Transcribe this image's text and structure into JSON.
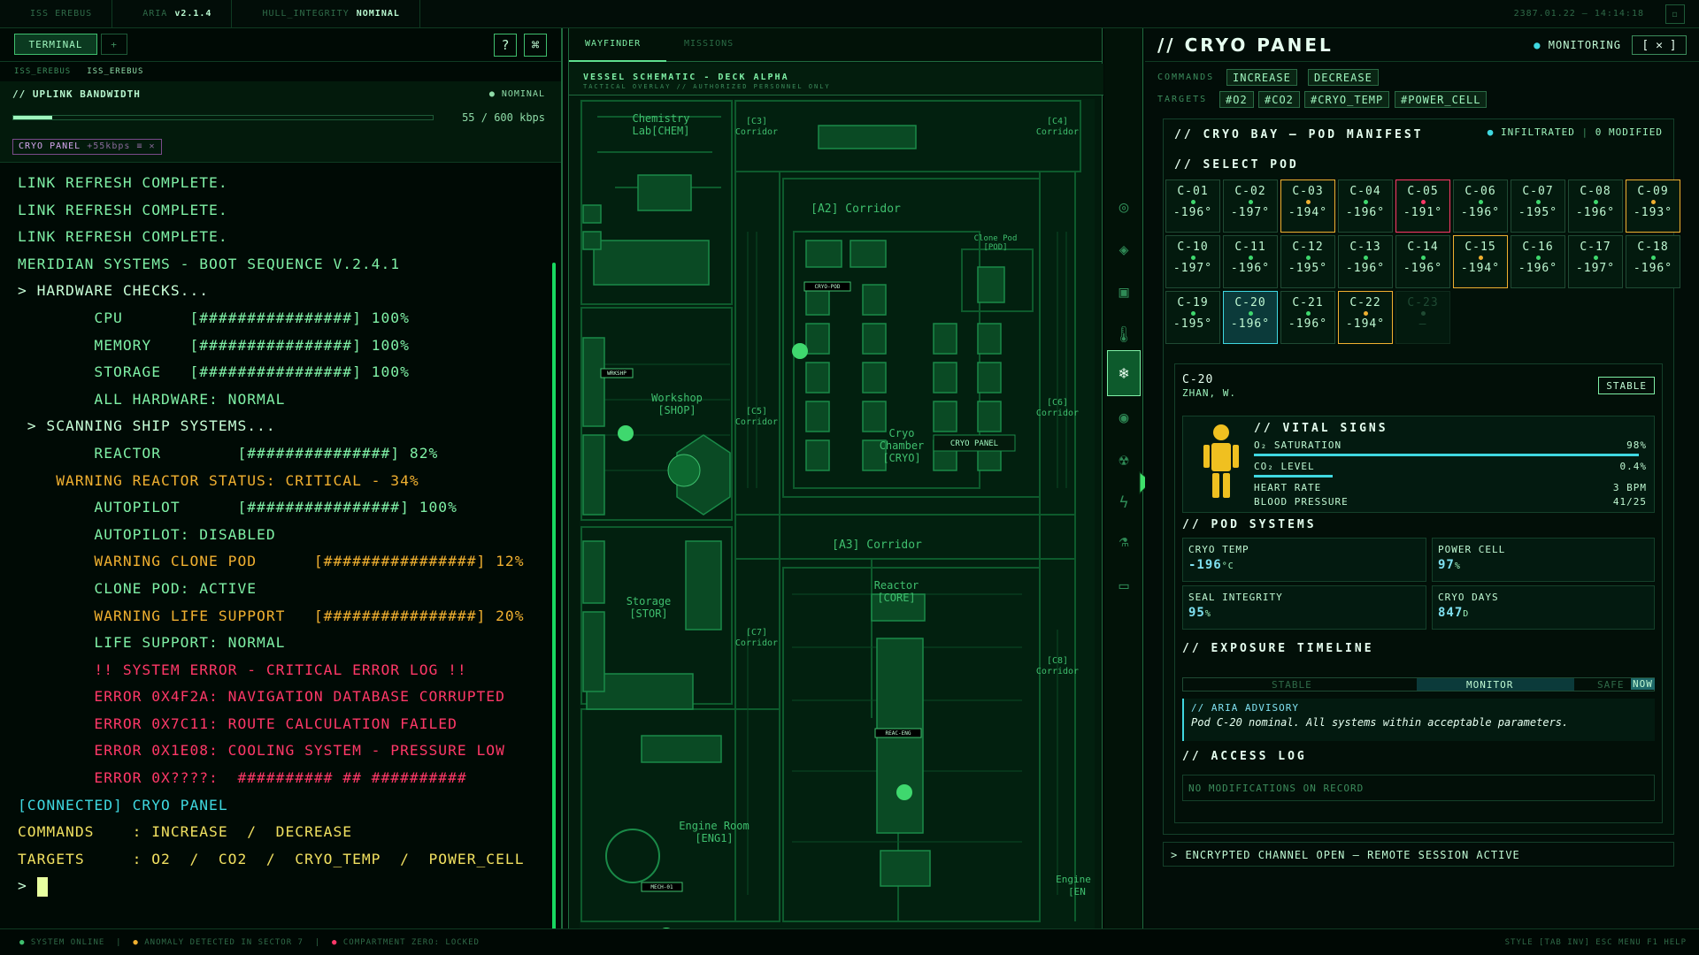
{
  "topbar": {
    "ship": "ISS EREBUS",
    "aria_label": "ARIA",
    "aria_version": "v2.1.4",
    "hull_label": "HULL_INTEGRITY",
    "hull_value": "NOMINAL",
    "datetime": "2387.01.22 — 14:14:18"
  },
  "left": {
    "tab_terminal": "TERMINAL",
    "tab_add": "+",
    "help_icon": "?",
    "cmd_icon": "⌘",
    "sub_ship": "ISS_EREBUS",
    "sub_active": "ISS_EREBUS",
    "uplink_title": "// UPLINK BANDWIDTH",
    "uplink_status": "● NOMINAL",
    "uplink_value": "55 / 600 kbps",
    "uplink_fraction": 0.092,
    "chip_label": "CRYO PANEL",
    "chip_detail": "+55kbps",
    "chip_close": "≡ ✕"
  },
  "terminal": {
    "lines": [
      {
        "t": "LINK REFRESH COMPLETE.",
        "c": "t-n"
      },
      {
        "t": "LINK REFRESH COMPLETE.",
        "c": "t-n"
      },
      {
        "t": "LINK REFRESH COMPLETE.",
        "c": "t-n"
      },
      {
        "t": "MERIDIAN SYSTEMS - BOOT SEQUENCE V.2.4.1",
        "c": "t-n"
      },
      {
        "t": "> HARDWARE CHECKS...",
        "c": "t-h"
      },
      {
        "t": "        CPU       [################] 100%",
        "c": "t-n"
      },
      {
        "t": "        MEMORY    [################] 100%",
        "c": "t-n"
      },
      {
        "t": "        STORAGE   [################] 100%",
        "c": "t-n"
      },
      {
        "t": "        ALL HARDWARE: NORMAL",
        "c": "t-n"
      },
      {
        "t": " > SCANNING SHIP SYSTEMS...",
        "c": "t-h"
      },
      {
        "t": "        REACTOR        [###############] 82%",
        "c": "t-n"
      },
      {
        "t": "    WARNING REACTOR STATUS: CRITICAL - 34%",
        "c": "t-w"
      },
      {
        "t": "        AUTOPILOT      [################] 100%",
        "c": "t-n"
      },
      {
        "t": "        AUTOPILOT: DISABLED",
        "c": "t-n"
      },
      {
        "t": "        WARNING CLONE POD      [################] 12%",
        "c": "t-w"
      },
      {
        "t": "        CLONE POD: ACTIVE",
        "c": "t-n"
      },
      {
        "t": "        WARNING LIFE SUPPORT   [################] 20%",
        "c": "t-w"
      },
      {
        "t": "        LIFE SUPPORT: NORMAL",
        "c": "t-n"
      },
      {
        "t": "        !! SYSTEM ERROR - CRITICAL ERROR LOG !!",
        "c": "t-e"
      },
      {
        "t": "        ERROR 0X4F2A: NAVIGATION DATABASE CORRUPTED",
        "c": "t-e"
      },
      {
        "t": "        ERROR 0X7C11: ROUTE CALCULATION FAILED",
        "c": "t-e"
      },
      {
        "t": "        ERROR 0X1E08: COOLING SYSTEM - PRESSURE LOW",
        "c": "t-e"
      },
      {
        "t": "        ERROR 0X????:  ########## ## ##########",
        "c": "t-e"
      },
      {
        "t": "[CONNECTED] CRYO PANEL",
        "c": "t-c"
      },
      {
        "t": "COMMANDS    : INCREASE  /  DECREASE",
        "c": "t-y"
      },
      {
        "t": "TARGETS     : O2  /  CO2  /  CRYO_TEMP  /  POWER_CELL",
        "c": "t-y"
      }
    ],
    "prompt": "> "
  },
  "mid": {
    "tab_wayfinder": "WAYFINDER",
    "tab_missions": "MISSIONS",
    "schematic_title": "VESSEL SCHEMATIC - DECK ALPHA",
    "schematic_sub": "TACTICAL OVERLAY // AUTHORIZED PERSONNEL ONLY",
    "rooms": {
      "chem1": "Chemistry",
      "chem2": "Lab[CHEM]",
      "c3": "[C3]",
      "c3b": "Corridor",
      "c4": "[C4]",
      "c4b": "Corridor",
      "a2": "[A2] Corridor",
      "clone1": "Clone Pod",
      "clone2": "[POD]",
      "cryo_label": "CRYO-POD",
      "shop1": "Workshop",
      "shop2": "[SHOP]",
      "shop_tag": "WRKSHP",
      "c5": "[C5]",
      "c5b": "Corridor",
      "cryo1": "Cryo",
      "cryo2": "Chamber",
      "cryo3": "[CRYO]",
      "c6": "[C6]",
      "c6b": "Corridor",
      "panel_tag": "CRYO PANEL",
      "a3": "[A3] Corridor",
      "stor1": "Storage",
      "stor2": "[STOR]",
      "c7": "[C7]",
      "c7b": "Corridor",
      "core1": "Reactor",
      "core2": "[CORE]",
      "c8": "[C8]",
      "c8b": "Corridor",
      "reac_tag": "REAC-ENG",
      "eng1": "Engine Room",
      "eng2": "[ENG1]",
      "mech_tag": "MECH-01",
      "eng_b1": "Engine",
      "eng_b2": "[EN"
    }
  },
  "rail": {
    "icons": [
      "radar-icon",
      "diamond-icon",
      "chip-icon",
      "thermometer-icon",
      "snowflake-icon",
      "target-icon",
      "radiation-icon",
      "lightning-icon",
      "flask-icon",
      "folder-icon"
    ],
    "glyphs": [
      "◎",
      "◈",
      "▣",
      "🌡",
      "❄",
      "◉",
      "☢",
      "ϟ",
      "⚗",
      "▭"
    ]
  },
  "right": {
    "title": "// CRYO PANEL",
    "monitoring": "MONITORING",
    "close": "[ ✕ ]",
    "commands_label": "COMMANDS",
    "commands": [
      "INCREASE",
      "DECREASE"
    ],
    "targets_label": "TARGETS",
    "targets": [
      "#O2",
      "#CO2",
      "#CRYO_TEMP",
      "#POWER_CELL"
    ],
    "manifest_title": "// CRYO BAY — POD MANIFEST",
    "infiltrated": "INFILTRATED",
    "modified": "0 MODIFIED",
    "select_title": "// SELECT POD",
    "pods": [
      {
        "id": "C-01",
        "temp": "-196°",
        "state": "ok"
      },
      {
        "id": "C-02",
        "temp": "-197°",
        "state": "ok"
      },
      {
        "id": "C-03",
        "temp": "-194°",
        "state": "warn"
      },
      {
        "id": "C-04",
        "temp": "-196°",
        "state": "ok"
      },
      {
        "id": "C-05",
        "temp": "-191°",
        "state": "crit"
      },
      {
        "id": "C-06",
        "temp": "-196°",
        "state": "ok"
      },
      {
        "id": "C-07",
        "temp": "-195°",
        "state": "ok"
      },
      {
        "id": "C-08",
        "temp": "-196°",
        "state": "ok"
      },
      {
        "id": "C-09",
        "temp": "-193°",
        "state": "warn"
      },
      {
        "id": "C-10",
        "temp": "-197°",
        "state": "ok"
      },
      {
        "id": "C-11",
        "temp": "-196°",
        "state": "ok"
      },
      {
        "id": "C-12",
        "temp": "-195°",
        "state": "ok"
      },
      {
        "id": "C-13",
        "temp": "-196°",
        "state": "ok"
      },
      {
        "id": "C-14",
        "temp": "-196°",
        "state": "ok"
      },
      {
        "id": "C-15",
        "temp": "-194°",
        "state": "warn"
      },
      {
        "id": "C-16",
        "temp": "-196°",
        "state": "ok"
      },
      {
        "id": "C-17",
        "temp": "-197°",
        "state": "ok"
      },
      {
        "id": "C-18",
        "temp": "-196°",
        "state": "ok"
      },
      {
        "id": "C-19",
        "temp": "-195°",
        "state": "ok"
      },
      {
        "id": "C-20",
        "temp": "-196°",
        "state": "sel"
      },
      {
        "id": "C-21",
        "temp": "-196°",
        "state": "ok"
      },
      {
        "id": "C-22",
        "temp": "-194°",
        "state": "warn"
      },
      {
        "id": "C-23",
        "temp": "—",
        "state": "off"
      }
    ],
    "detail": {
      "id": "C-20",
      "name": "ZHAN, W.",
      "status": "STABLE",
      "vitals_title": "// VITAL SIGNS",
      "o2_label": "O₂ SATURATION",
      "o2_value": "98%",
      "o2_fraction": 0.98,
      "co2_label": "CO₂ LEVEL",
      "co2_value": "0.4%",
      "co2_fraction": 0.2,
      "hr_label": "HEART RATE",
      "hr_value": "3 BPM",
      "bp_label": "BLOOD PRESSURE",
      "bp_value": "41/25",
      "systems_title": "// POD SYSTEMS",
      "temp_label": "CRYO TEMP",
      "temp_value": "-196",
      "temp_unit": "°C",
      "power_label": "POWER CELL",
      "power_value": "97",
      "power_unit": "%",
      "seal_label": "SEAL INTEGRITY",
      "seal_value": "95",
      "seal_unit": "%",
      "days_label": "CRYO DAYS",
      "days_value": "847",
      "days_unit": "D",
      "timeline_title": "// EXPOSURE TIMELINE",
      "tl_stable": "STABLE",
      "tl_monitor": "MONITOR",
      "tl_safe": "SAFE",
      "tl_now": "NOW",
      "advisory_title": "// ARIA ADVISORY",
      "advisory_text": "Pod C-20 nominal. All systems within acceptable parameters.",
      "access_title": "// ACCESS LOG",
      "access_text": "NO MODIFICATIONS ON RECORD"
    },
    "encrypted": "> ENCRYPTED CHANNEL OPEN — REMOTE SESSION ACTIVE"
  },
  "status": {
    "s1": "SYSTEM ONLINE",
    "s2": "ANOMALY DETECTED IN SECTOR 7",
    "s3": "COMPARTMENT ZERO: LOCKED",
    "right": "STYLE [TAB INV]   ESC  MENU   F1  HELP"
  },
  "colors": {
    "accent": "#5ee08e",
    "warn": "#f0b030",
    "crit": "#ff3868",
    "cyan": "#3fd8e0"
  }
}
